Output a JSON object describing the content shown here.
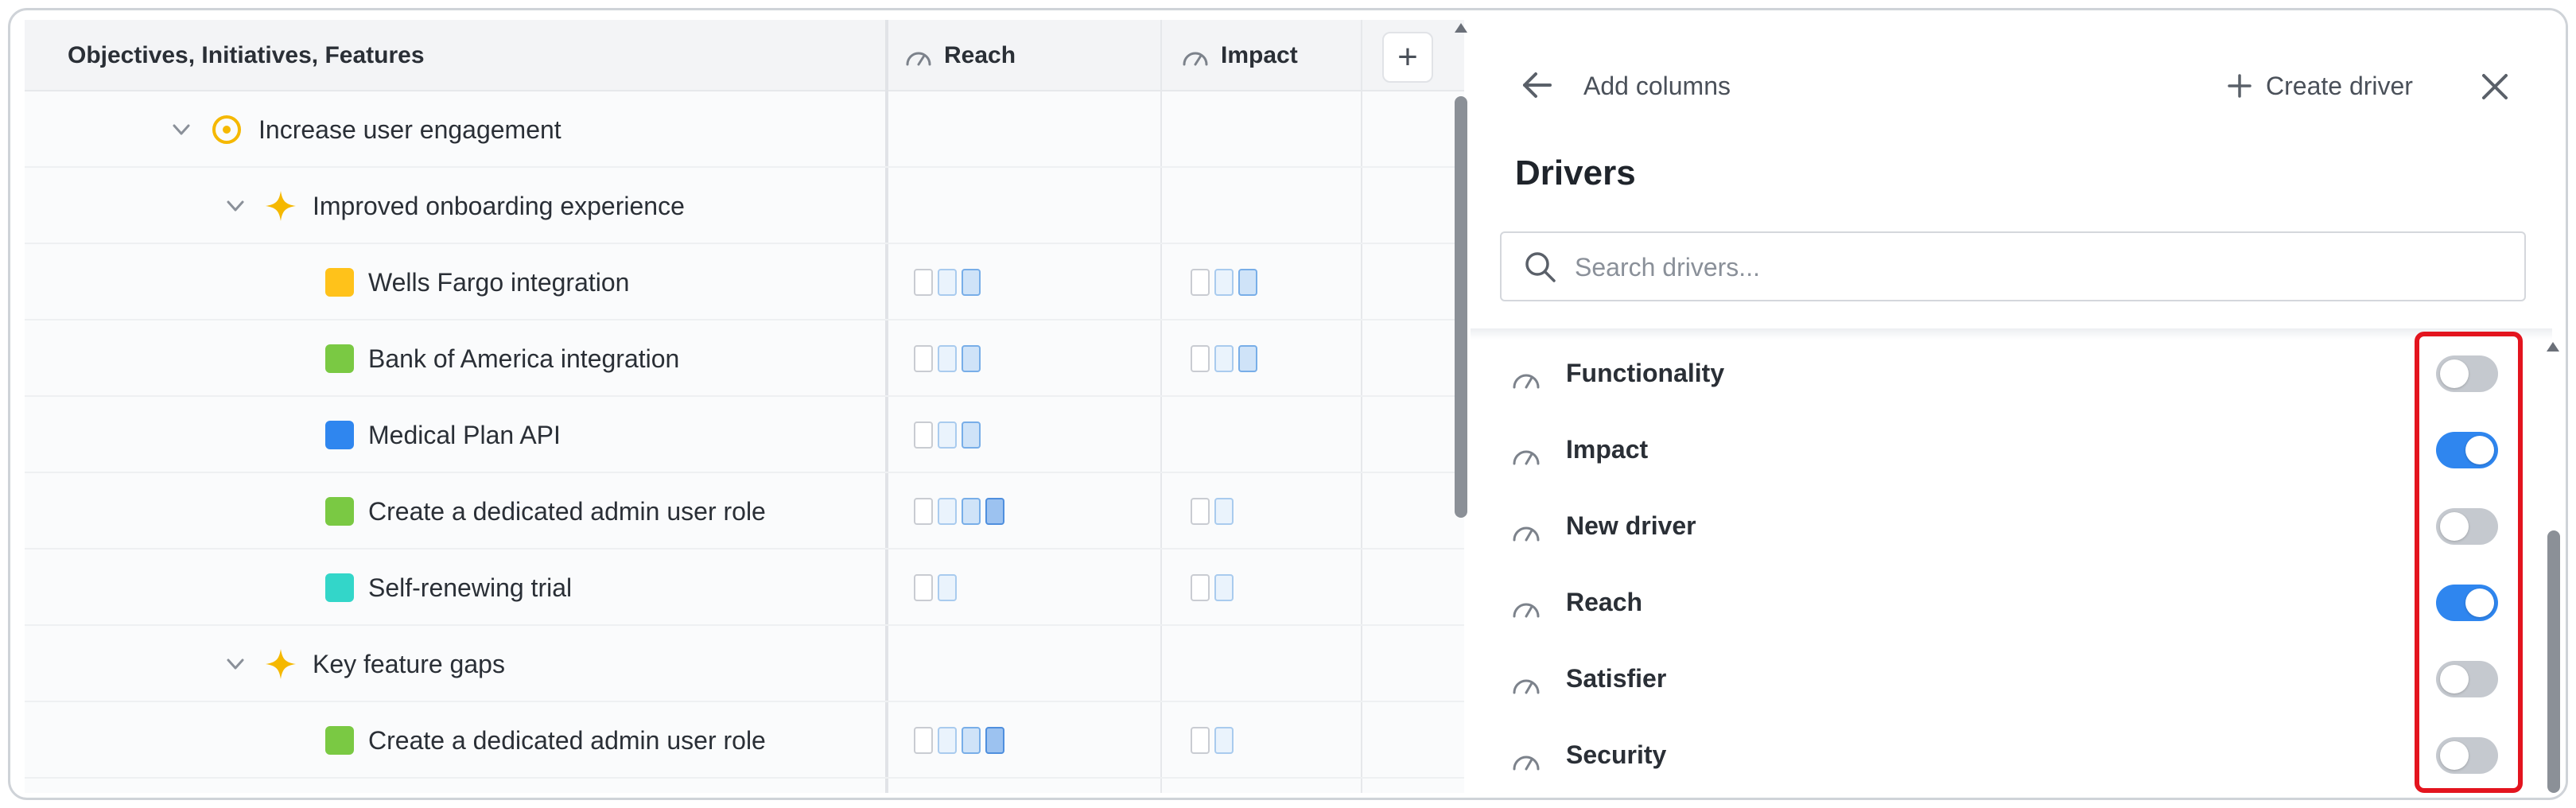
{
  "table": {
    "header_title": "Objectives, Initiatives, Features",
    "columns": [
      {
        "label": "Reach",
        "icon": "gauge-icon"
      },
      {
        "label": "Impact",
        "icon": "gauge-icon"
      }
    ],
    "add_column_glyph": "+",
    "rows": [
      {
        "label": "Increase user engagement",
        "type": "objective",
        "icon": "target-icon",
        "color": "#f5b800",
        "reach": null,
        "impact": null
      },
      {
        "label": "Improved onboarding experience",
        "type": "initiative",
        "icon": "sparkle-icon",
        "color": "#f5b800",
        "reach": null,
        "impact": null
      },
      {
        "label": "Wells Fargo integration",
        "type": "feature",
        "color": "#ffc21a",
        "reach": [
          0,
          1,
          2
        ],
        "impact": [
          0,
          1,
          2
        ]
      },
      {
        "label": "Bank of America integration",
        "type": "feature",
        "color": "#7ac943",
        "reach": [
          0,
          1,
          2
        ],
        "impact": [
          0,
          1,
          2
        ]
      },
      {
        "label": "Medical Plan API",
        "type": "feature",
        "color": "#2f86ef",
        "reach": [
          0,
          1,
          2
        ],
        "impact": null
      },
      {
        "label": "Create a dedicated admin user role",
        "type": "feature",
        "color": "#7ac943",
        "reach": [
          0,
          1,
          2,
          3
        ],
        "impact": [
          0,
          1
        ]
      },
      {
        "label": "Self-renewing trial",
        "type": "feature",
        "color": "#33d6c9",
        "reach": [
          0,
          1
        ],
        "impact": [
          0,
          1
        ]
      },
      {
        "label": "Key feature gaps",
        "type": "initiative",
        "icon": "sparkle-icon",
        "color": "#f5b800",
        "reach": null,
        "impact": null
      },
      {
        "label": "Create a dedicated admin user role",
        "type": "feature",
        "color": "#7ac943",
        "reach": [
          0,
          1,
          2,
          3
        ],
        "impact": [
          0,
          1
        ]
      }
    ]
  },
  "panel": {
    "back_label": "Add columns",
    "create_driver_label": "Create driver",
    "heading": "Drivers",
    "search_placeholder": "Search drivers...",
    "drivers": [
      {
        "label": "Functionality",
        "enabled": false
      },
      {
        "label": "Impact",
        "enabled": true
      },
      {
        "label": "New driver",
        "enabled": false
      },
      {
        "label": "Reach",
        "enabled": true
      },
      {
        "label": "Satisfier",
        "enabled": false
      },
      {
        "label": "Security",
        "enabled": false
      }
    ]
  },
  "colors": {
    "toggle_on": "#2f86ef",
    "toggle_off": "#c5c9cf",
    "highlight": "#e3141e"
  }
}
